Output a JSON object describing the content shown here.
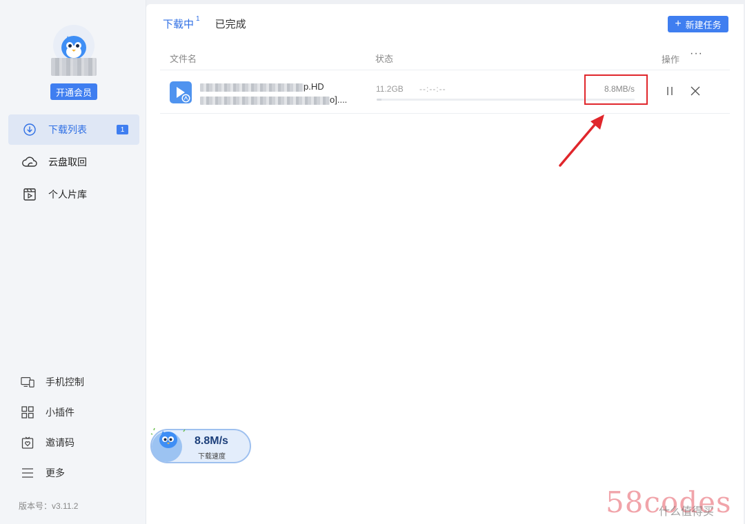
{
  "sidebar": {
    "vip_button": "开通会员",
    "nav": [
      {
        "label": "下载列表",
        "icon": "download-circle-icon",
        "badge": "1",
        "active": true
      },
      {
        "label": "云盘取回",
        "icon": "cloud-icon",
        "active": false
      },
      {
        "label": "个人片库",
        "icon": "film-library-icon",
        "active": false
      }
    ],
    "bottom_nav": [
      {
        "label": "手机控制",
        "icon": "phone-monitor-icon"
      },
      {
        "label": "小插件",
        "icon": "grid-icon"
      },
      {
        "label": "邀请码",
        "icon": "gift-icon"
      },
      {
        "label": "更多",
        "icon": "menu-icon"
      }
    ],
    "version": "版本号：v3.11.2"
  },
  "main": {
    "tabs": [
      {
        "label": "下载中",
        "count": "1",
        "active": true
      },
      {
        "label": "已完成",
        "active": false
      }
    ],
    "new_task_button": "新建任务",
    "table_headers": {
      "name": "文件名",
      "status": "状态",
      "operation": "操作",
      "more": "···"
    },
    "rows": [
      {
        "name_line1_suffix": "p.HD",
        "name_line2_suffix": "o]....",
        "size": "11.2GB",
        "eta": "--:--:--",
        "speed": "8.8MB/s",
        "progress": 0.02
      }
    ]
  },
  "speed_widget": {
    "speed": "8.8M/s",
    "label": "下载速度"
  },
  "watermark": {
    "text": "58codes",
    "text2": "什么值得买"
  },
  "colors": {
    "accent": "#3f7ef0",
    "highlight": "#e0262b"
  }
}
